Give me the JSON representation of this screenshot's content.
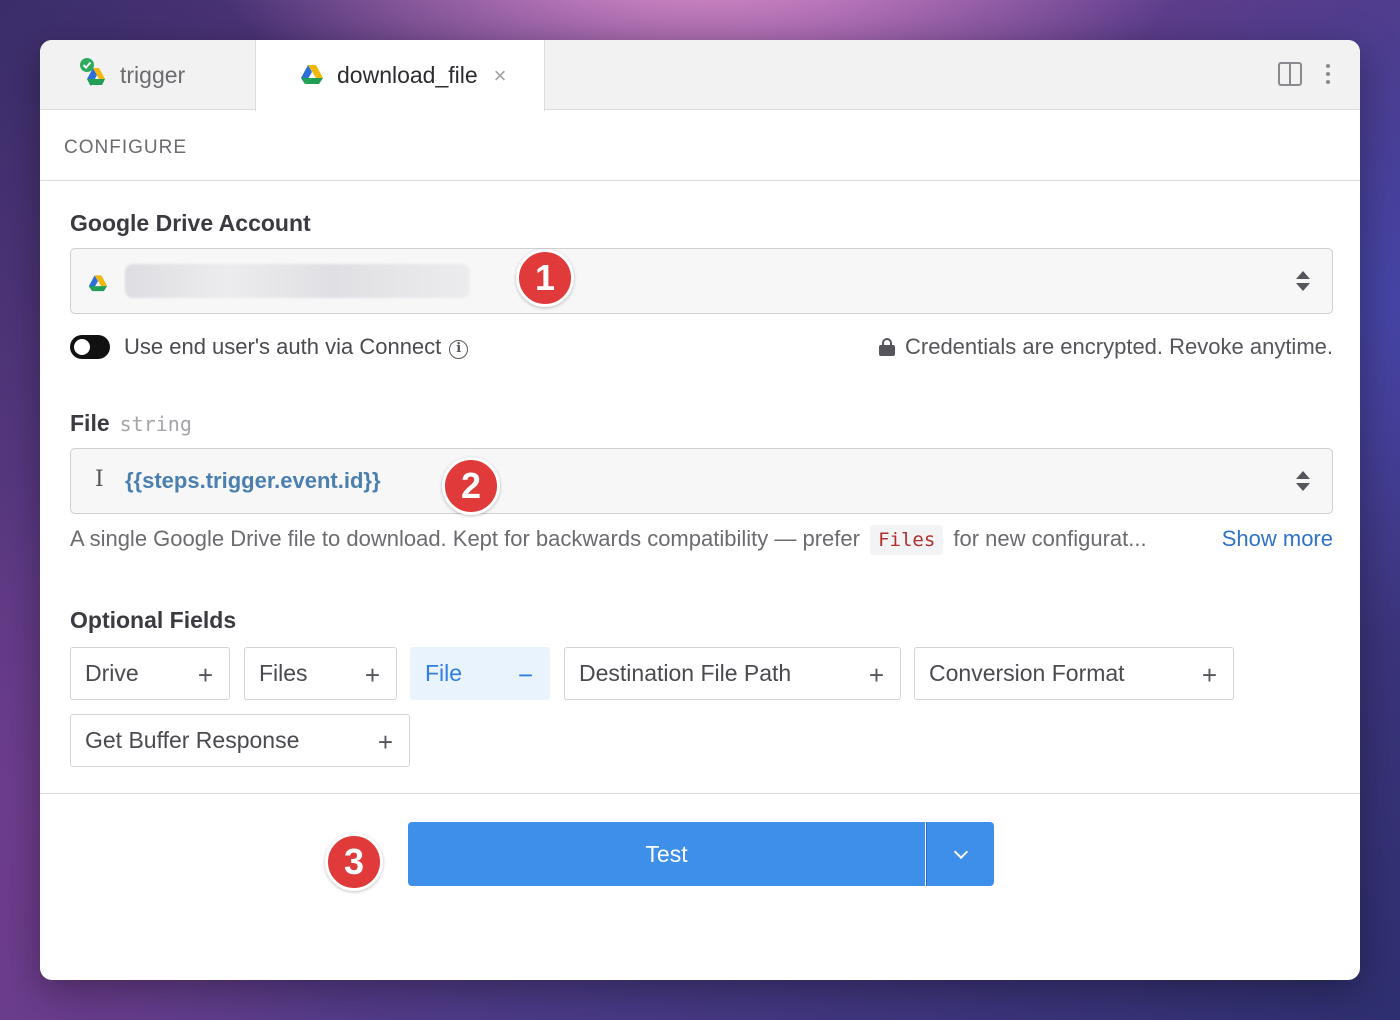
{
  "tabs": [
    {
      "label": "trigger",
      "icon": "google-drive-check-icon"
    },
    {
      "label": "download_file",
      "icon": "google-drive-icon",
      "close": "×"
    }
  ],
  "section_header": "CONFIGURE",
  "account": {
    "label": "Google Drive Account",
    "badge": "1"
  },
  "auth_toggle": {
    "label": "Use end user's auth via Connect",
    "info_icon": "i",
    "credentials_note": "Credentials are encrypted. Revoke anytime."
  },
  "file_field": {
    "label": "File",
    "type": "string",
    "value": "{{steps.trigger.event.id}}",
    "badge": "2",
    "description_before": "A single Google Drive file to download. Kept for backwards compatibility — prefer",
    "description_code": "Files",
    "description_after": "for new configurat...",
    "show_more": "Show more"
  },
  "optional_fields": {
    "label": "Optional Fields",
    "chips": [
      {
        "label": "Drive",
        "symbol": "+"
      },
      {
        "label": "Files",
        "symbol": "+"
      },
      {
        "label": "File",
        "symbol": "−"
      },
      {
        "label": "Destination File Path",
        "symbol": "+"
      },
      {
        "label": "Conversion Format",
        "symbol": "+"
      },
      {
        "label": "Get Buffer Response",
        "symbol": "+"
      }
    ]
  },
  "test_button": {
    "label": "Test",
    "badge": "3"
  },
  "colors": {
    "primary": "#3d8fea",
    "badge": "#e03a3a",
    "link": "#2f73c8",
    "code": "#b03030"
  }
}
